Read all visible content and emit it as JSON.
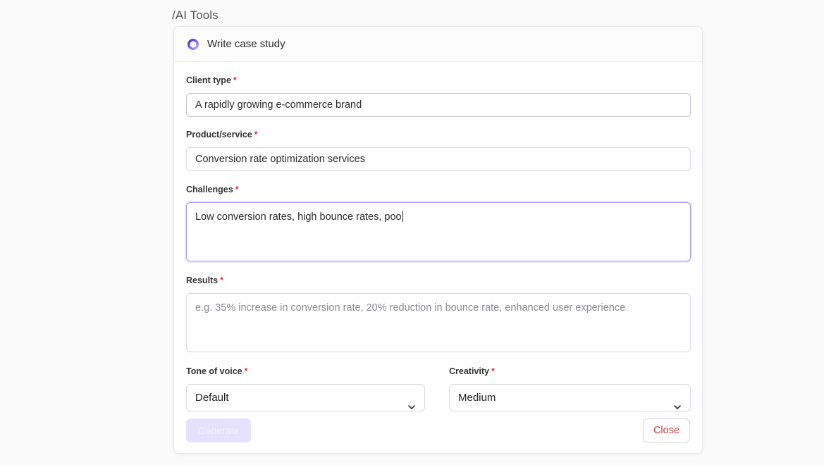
{
  "breadcrumb": "/AI Tools",
  "card": {
    "title": "Write case study",
    "icon": "spinner-ring-icon"
  },
  "form": {
    "required_marker": "*",
    "client_type": {
      "label": "Client type",
      "value": "A rapidly growing e-commerce brand"
    },
    "product_service": {
      "label": "Product/service",
      "value": "Conversion rate optimization services"
    },
    "challenges": {
      "label": "Challenges",
      "value": "Low conversion rates, high bounce rates, poo"
    },
    "results": {
      "label": "Results",
      "placeholder": "e.g. 35% increase in conversion rate, 20% reduction in bounce rate, enhanced user experience"
    },
    "tone_of_voice": {
      "label": "Tone of voice",
      "selected": "Default"
    },
    "creativity": {
      "label": "Creativity",
      "selected": "Medium"
    }
  },
  "actions": {
    "generate_label": "Generate",
    "close_label": "Close"
  },
  "colors": {
    "accent": "#7c5cf0",
    "required": "#e0344b",
    "close_text": "#c8413f",
    "generate_disabled_bg": "#e6e2fd"
  }
}
